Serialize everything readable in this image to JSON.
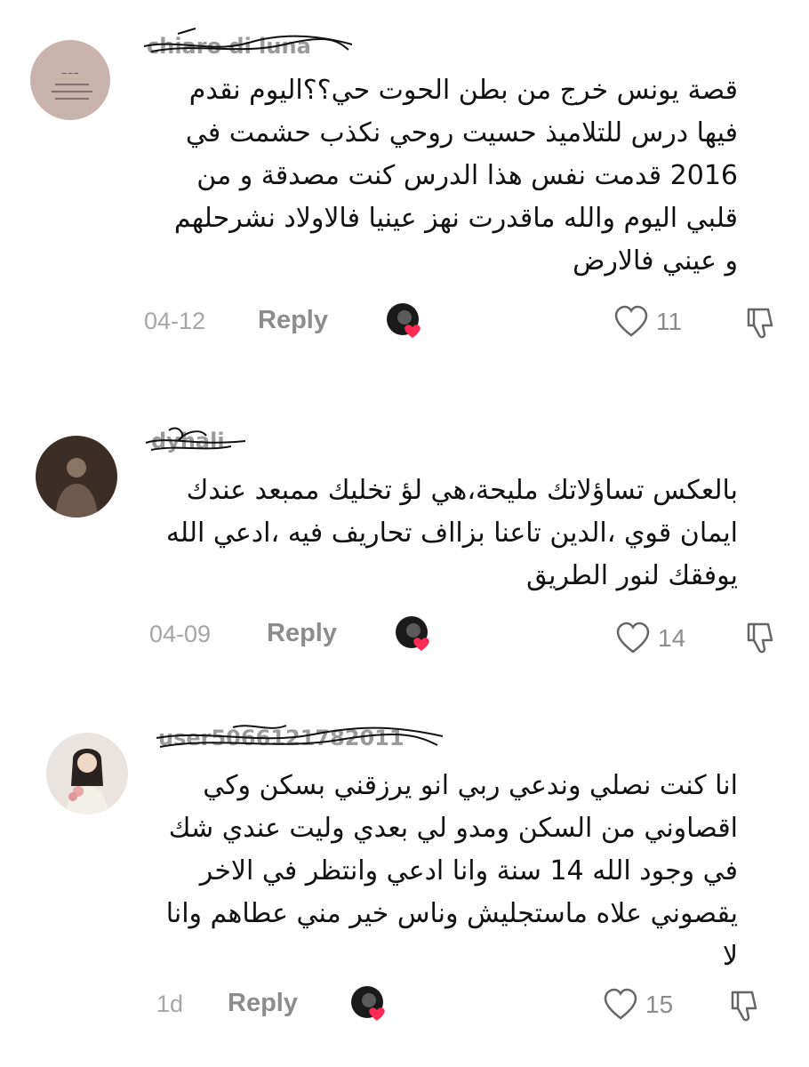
{
  "comments": [
    {
      "username": "chiaro di luna",
      "text": "قصة يونس خرج من بطن الحوت حي؟؟اليوم نقدم\nفيها درس للتلاميذ حسيت روحي نكذب حشمت في\n2016 قدمت نفس هذا الدرس كنت مصدقة و من\nقلبي اليوم والله ماقدرت نهز عينيا فالاولاد نشرحلهم\nو عيني فالارض",
      "date": "04-12",
      "reply_label": "Reply",
      "likes": "11"
    },
    {
      "username": "dyhali",
      "text": "بالعكس تساؤلاتك مليحة،هي لؤ تخليك ممبعد عندك\nايمان قوي ،الدين تاعنا بزااف تحاريف فيه ،ادعي الله\nيوفقك لنور الطريق",
      "date": "04-09",
      "reply_label": "Reply",
      "likes": "14"
    },
    {
      "username": "user5066121782011",
      "text": "انا كنت نصلي وندعي ربي انو يرزقني بسكن وكي\nاقصاوني من السكن ومدو لي بعدي وليت عندي شك\nفي وجود الله 14 سنة وانا ادعي وانتظر في الاخر\nيقصوني علاه ماستجليش وناس خير مني عطاهم وانا\nلا",
      "date": "1d",
      "reply_label": "Reply",
      "likes": "15"
    }
  ],
  "icons": {
    "like": "heart-outline-icon",
    "dislike": "thumbs-down-outline-icon",
    "creator_liked": "creator-liked-icon"
  },
  "colors": {
    "heart_badge": "#fe2c55",
    "meta_text": "#8c8c8c"
  }
}
